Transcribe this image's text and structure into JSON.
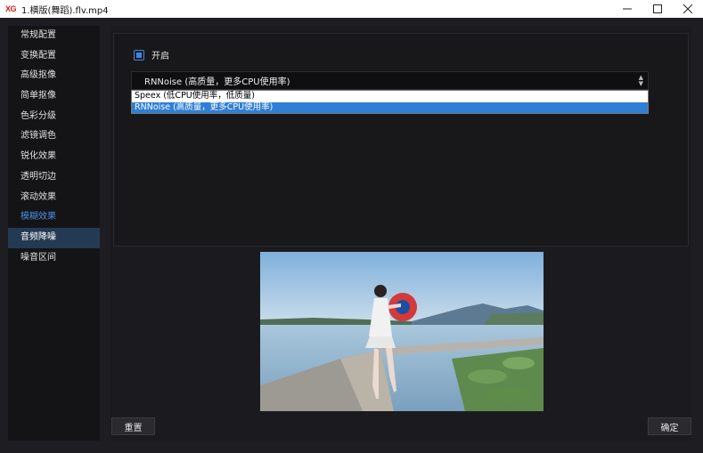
{
  "window": {
    "logo": "XG",
    "title": "1.横版(舞蹈).flv.mp4",
    "minimize": "─",
    "close": "✕"
  },
  "sidebar": {
    "items": [
      {
        "label": "常规配置"
      },
      {
        "label": "变换配置"
      },
      {
        "label": "高级抠像"
      },
      {
        "label": "简单抠像"
      },
      {
        "label": "色彩分级"
      },
      {
        "label": "滤镜调色"
      },
      {
        "label": "锐化效果"
      },
      {
        "label": "透明切边"
      },
      {
        "label": "滚动效果"
      },
      {
        "label": "模糊效果"
      },
      {
        "label": "音频降噪"
      },
      {
        "label": "噪音区间"
      }
    ],
    "highlighted_text_index": 9,
    "selected_index": 10
  },
  "settings": {
    "enable_label": "开启",
    "enable_checked": true,
    "method_selected": "RNNoise (高质量，更多CPU使用率)",
    "method_options": [
      "Speex (低CPU使用率，低质量)",
      "RNNoise (高质量，更多CPU使用率)"
    ],
    "highlighted_option_index": 1
  },
  "buttons": {
    "reset": "重置",
    "ok": "确定"
  },
  "colors": {
    "accent": "#3f86e0",
    "selected_bg": "#243a52",
    "dropdown_highlight": "#2f7fd6",
    "logo": "#d81e1e"
  }
}
